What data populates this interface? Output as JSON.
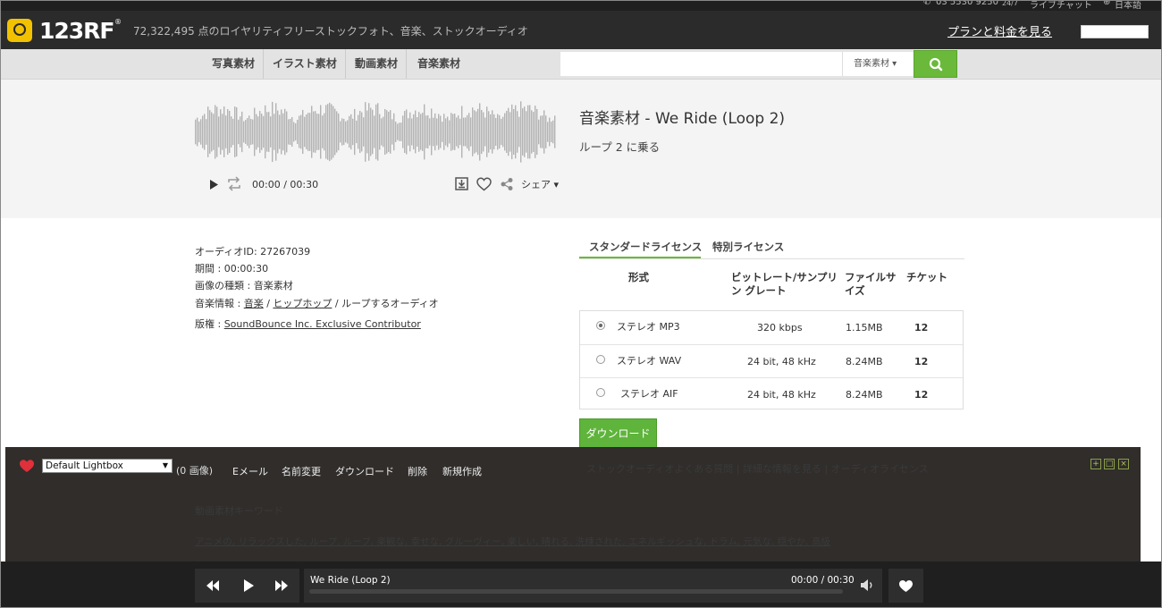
{
  "topbar": {
    "phone": "03 5530 9250",
    "hours": "24/7",
    "chat": "ライブチャット",
    "language": "日本語"
  },
  "header": {
    "logo": "123RF",
    "logo_mark": "®",
    "tagline": "72,322,495 点のロイヤリティフリーストックフォト、音楽、ストックオーディオ",
    "plans_link": "プランと料金を見る"
  },
  "nav": {
    "items": [
      "写真素材",
      "イラスト素材",
      "動画素材",
      "音楽素材"
    ],
    "search_value": "",
    "search_type": "音楽素材 ▾"
  },
  "audio": {
    "title": "音楽素材 - We Ride (Loop 2)",
    "subtitle": "ループ 2 に乗る",
    "time": "00:00 / 00:30",
    "share": "シェア ▾"
  },
  "info": {
    "audio_id": "オーディオID: 27267039",
    "duration": "期間 : 00:00:30",
    "media_type": "画像の種類 : 音楽素材",
    "music_info_label": "音楽情報 : ",
    "genre_music": "音楽",
    "sep1": " / ",
    "genre_hiphop": "ヒップホップ",
    "sep2": " / ",
    "loop": "ループするオーディオ",
    "copyright_label": "版権 : ",
    "copyright": "SoundBounce Inc. Exclusive Contributor"
  },
  "license": {
    "tabs": [
      "スタンダードライセンス",
      "特別ライセンス"
    ],
    "headers": {
      "format": "形式",
      "bitrate": "ビットレート/サンプリン グレート",
      "filesize": "ファイルサ イズ",
      "ticket": "チケット"
    },
    "rows": [
      {
        "format": "ステレオ MP3",
        "bitrate": "320 kbps",
        "size": "1.15MB",
        "ticket": "12",
        "selected": true
      },
      {
        "format": "ステレオ WAV",
        "bitrate": "24 bit, 48 kHz",
        "size": "8.24MB",
        "ticket": "12",
        "selected": false
      },
      {
        "format": "ステレオ AIF",
        "bitrate": "24 bit, 48 kHz",
        "size": "8.24MB",
        "ticket": "12",
        "selected": false
      }
    ],
    "download": "ダウンロード"
  },
  "faded": {
    "links": "ストックオーディオよくある質問 | 詳細な情報を見る | オーディオライセンス",
    "keywords_title": "動画素材キーワード",
    "keywords": "アニメの, リラックスした, ループ, ループ, 楽観な, 幸せな, グルーヴィー, 楽しい, 晴れる, 洗練された, エネルギッシュな, ドラム, 元気な, 穏やか, 高級"
  },
  "lightbox": {
    "selected": "Default Lightbox",
    "count": "(0 画像)",
    "actions": [
      "Eメール",
      "名前変更",
      "ダウンロード",
      "削除",
      "新規作成"
    ],
    "controls": [
      "+",
      "□",
      "×"
    ]
  },
  "player": {
    "title": "We Ride (Loop 2)",
    "time": "00:00 / 00:30",
    "progress": 0
  },
  "colors": {
    "accent_green": "#6ab93a",
    "logo_yellow": "#f2c200",
    "heart_red": "#e0303a"
  }
}
